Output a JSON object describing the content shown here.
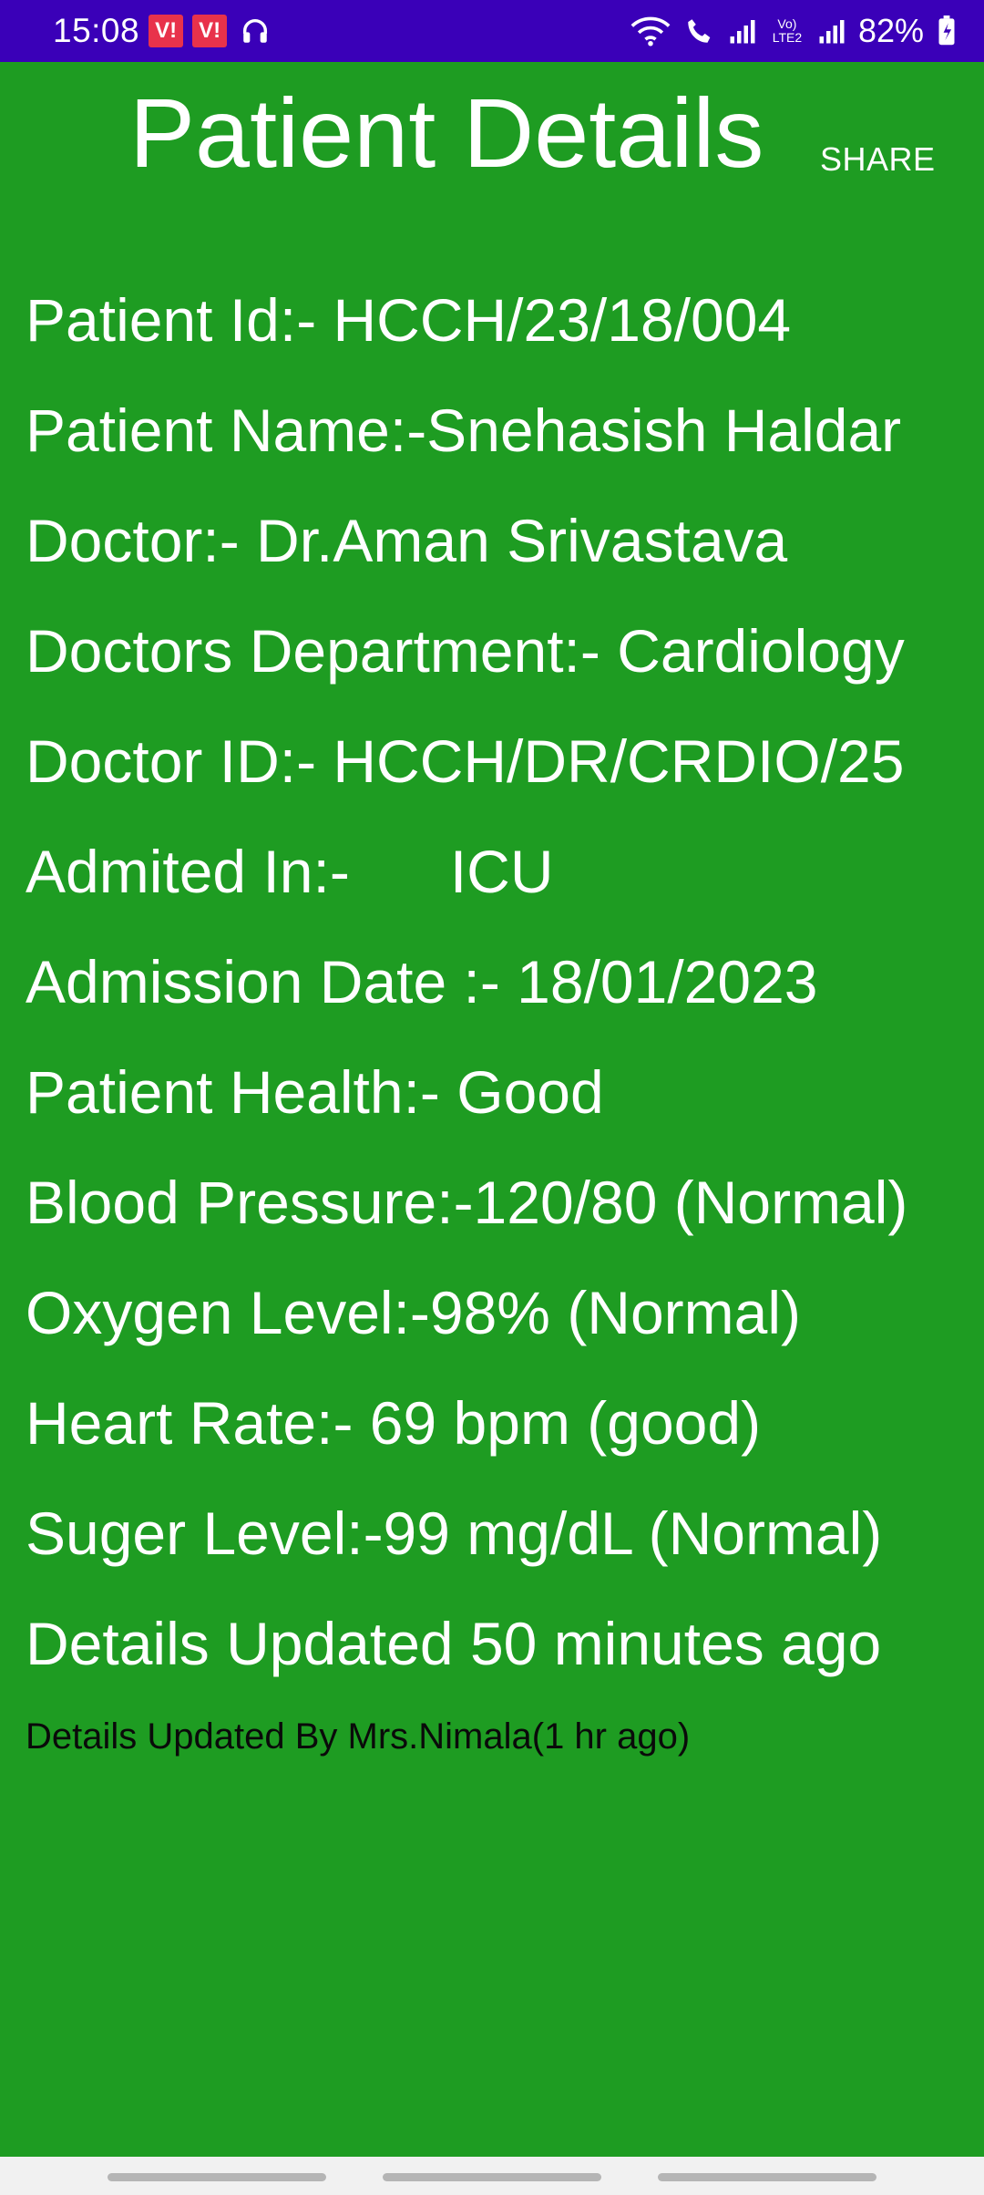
{
  "status_bar": {
    "time": "15:08",
    "carrier_badges": [
      "V!",
      "V!"
    ],
    "battery": "82%",
    "network_label": "Vo) LTE2"
  },
  "header": {
    "title": "Patient Details",
    "share_label": "SHARE"
  },
  "details": [
    "Patient Id:- HCCH/23/18/004",
    "Patient Name:-Snehasish Haldar",
    "Doctor:- Dr.Aman Srivastava",
    "Doctors Department:- Cardiology",
    "Doctor ID:- HCCH/DR/CRDIO/25",
    "Admited In:-      ICU",
    "Admission Date :- 18/01/2023",
    "Patient Health:- Good",
    "Blood Pressure:-120/80 (Normal)",
    "Oxygen Level:-98% (Normal)",
    "Heart Rate:- 69 bpm (good)",
    "Suger Level:-99 mg/dL (Normal)",
    "Details Updated 50 minutes ago"
  ],
  "footer_note": "Details Updated By Mrs.Nimala(1 hr ago)",
  "colors": {
    "status_bar": "#3a00b8",
    "background": "#1e9c22",
    "text": "#ffffff",
    "note_text": "#0a0a0a"
  }
}
